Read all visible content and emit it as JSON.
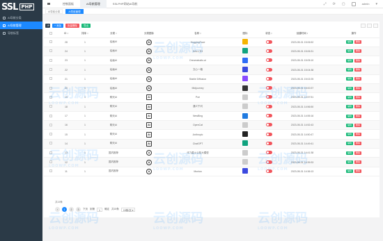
{
  "brand": {
    "ssl": "SSL",
    "php": "PHP"
  },
  "sidebar": {
    "items": [
      {
        "label": "AI导航分类",
        "active": false
      },
      {
        "label": "AI导航管理",
        "active": true
      },
      {
        "label": "导航标签",
        "active": false
      }
    ]
  },
  "topbar": {
    "tabs": [
      {
        "label": "控制面板",
        "active": false
      },
      {
        "label": "AI导航管理",
        "active": true
      },
      {
        "label": "SSLPHP网站AI导航",
        "active": false
      }
    ],
    "user": "admin"
  },
  "breadcrumb": [
    {
      "label": "AI导航分类",
      "active": false
    },
    {
      "label": "AI导航管理",
      "active": true
    }
  ],
  "toolbar": {
    "refresh": "⟳",
    "add": "+ 添加",
    "delete": "批量删除",
    "export": "导出"
  },
  "table": {
    "headers": [
      "",
      "ID ↕",
      "排序 ↕",
      "分类 ↕",
      "分类图标",
      "名称 ↕",
      "图标",
      "状态 ↕",
      "创建时间 ↕",
      "操作"
    ],
    "edit_label": "编辑",
    "delete_label": "删除",
    "rows": [
      {
        "id": "28",
        "sort": "1",
        "cat": "绘画AI",
        "ficon": "AI",
        "name": "HuggingFace",
        "color": "#f5b400",
        "time": "2023-05-31 15:06:52"
      },
      {
        "id": "24",
        "sort": "1",
        "cat": "绘画AI",
        "ficon": "AI",
        "name": "DALL·E3",
        "color": "#10a37f",
        "time": "2023-05-31 15:06:31"
      },
      {
        "id": "23",
        "sort": "1",
        "cat": "绘画AI",
        "ficon": "AI",
        "name": "Dreamstudio.ai",
        "color": "#2f6df6",
        "time": "2023-05-31 15:05:10"
      },
      {
        "id": "22",
        "sort": "1",
        "cat": "绘画AI",
        "ficon": "AI",
        "name": "文心一格",
        "color": "#3b49df",
        "time": "2023-05-31 15:04:38"
      },
      {
        "id": "21",
        "sort": "1",
        "cat": "绘画AI",
        "ficon": "AI",
        "name": "Stable Diffusion",
        "color": "#8a4bff",
        "time": "2023-05-31 15:02:25"
      },
      {
        "id": "20",
        "sort": "1",
        "cat": "绘画AI",
        "ficon": "AI",
        "name": "Midjourney",
        "color": "#333333",
        "time": "2023-05-31 15:00:37"
      },
      {
        "id": "19",
        "sort": "1",
        "cat": "聊天AI",
        "ficon": "Ai",
        "name": "Poe",
        "color": "#cccccc",
        "time": "2023-05-31 14:57:51"
      },
      {
        "id": "18",
        "sort": "1",
        "cat": "聊天AI",
        "ficon": "Ai",
        "name": "通义千问",
        "color": "#cccccc",
        "time": "2023-05-31 14:56:50"
      },
      {
        "id": "17",
        "sort": "1",
        "cat": "聊天AI",
        "ficon": "Ai",
        "name": "NewBing",
        "color": "#1f7ae0",
        "time": "2023-05-31 14:55:16"
      },
      {
        "id": "16",
        "sort": "1",
        "cat": "聊天AI",
        "ficon": "Ai",
        "name": "OpenCat",
        "color": "#cccccc",
        "time": "2023-05-31 14:52:43"
      },
      {
        "id": "15",
        "sort": "1",
        "cat": "聊天AI",
        "ficon": "Ai",
        "name": "Anthropic",
        "color": "#222222",
        "time": "2023-05-31 14:50:47"
      },
      {
        "id": "14",
        "sort": "1",
        "cat": "聊天AI",
        "ficon": "Ai",
        "name": "ChatGPT",
        "color": "#10a37f",
        "time": "2023-05-31 14:49:41"
      },
      {
        "id": "13",
        "sort": "1",
        "cat": "国内推荐",
        "ficon": "A",
        "name": "讯飞星火认知大模型",
        "color": "#cccccc",
        "time": "2023-05-31 14:41:38"
      },
      {
        "id": "12",
        "sort": "1",
        "cat": "国内推荐",
        "ficon": "A",
        "name": "",
        "color": "#cccccc",
        "time": "2023-05-31 14:39:33"
      },
      {
        "id": "11",
        "sort": "1",
        "cat": "国内推荐",
        "ficon": "A",
        "name": "Monica",
        "color": "#3b49df",
        "time": "2023-05-31 14:36:13"
      }
    ]
  },
  "footer": {
    "total": "共15条",
    "pages": [
      "1",
      "2",
      "3"
    ],
    "next": "下页",
    "goto": "到第",
    "go": "确定",
    "total_page": "共15条",
    "per_page": "15条/页 ▾"
  },
  "watermark": {
    "cn": "云创源码",
    "en": "LOOWP.COM"
  }
}
